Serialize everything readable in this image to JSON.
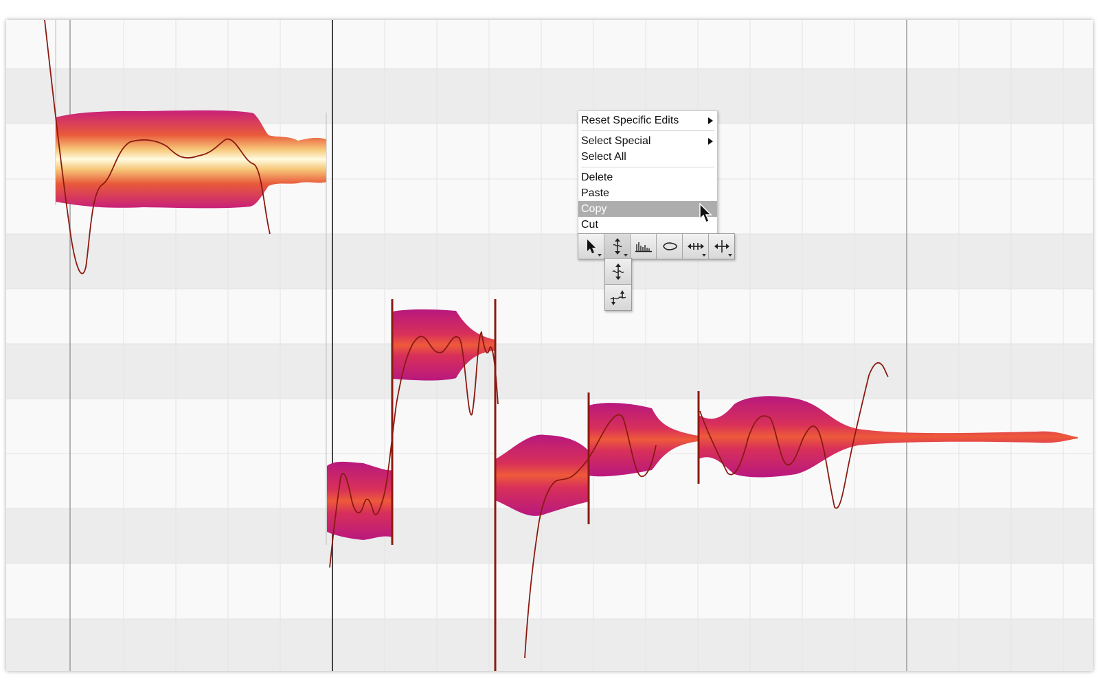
{
  "context_menu": {
    "items": [
      {
        "label": "Reset Specific Edits",
        "submenu": true
      },
      {
        "label": "Select Special",
        "submenu": true
      },
      {
        "label": "Select All",
        "submenu": false
      },
      {
        "label": "Delete",
        "submenu": false
      },
      {
        "label": "Paste",
        "submenu": false
      },
      {
        "label": "Copy",
        "submenu": false,
        "highlighted": true
      },
      {
        "label": "Cut",
        "submenu": false
      }
    ]
  },
  "toolbar": {
    "tools": [
      {
        "icon": "arrow-pointer-icon",
        "active": false
      },
      {
        "icon": "pitch-tool-icon",
        "active": true
      },
      {
        "icon": "formant-tool-icon",
        "active": false
      },
      {
        "icon": "amplitude-tool-icon",
        "active": false
      },
      {
        "icon": "time-tool-icon",
        "active": false
      },
      {
        "icon": "separation-tool-icon",
        "active": false
      }
    ],
    "pitch_submenu": [
      "pitch-modulation-icon",
      "pitch-drift-icon"
    ]
  },
  "colors": {
    "row_light": "#f9f9f9",
    "row_dark": "#ececec",
    "blob_magenta": "#c8207a",
    "blob_red": "#e84a3a",
    "blob_yellow": "#fff7c8",
    "pitch_curve": "#8a1a10",
    "menu_highlight": "#adadad"
  }
}
